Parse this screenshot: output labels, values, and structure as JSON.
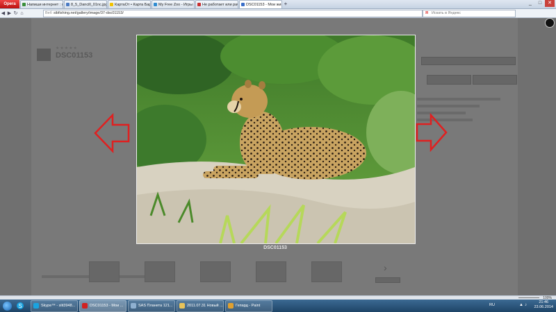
{
  "browser": {
    "menu_label": "Opera",
    "tabs": [
      {
        "label": "Напиши интернет : соо...",
        "color": "#3a8f3a"
      },
      {
        "label": "8_5_Dancill_01nc.jpg (800...",
        "color": "#4b7bc4"
      },
      {
        "label": "КартаОт • Карта Барн...",
        "color": "#f2c200"
      },
      {
        "label": "My Free Zoo - Игры в ...",
        "color": "#2f8bd0"
      },
      {
        "label": "Не работает или рабо...",
        "color": "#c83030"
      },
      {
        "label": "DSC01153 - Мои живо...",
        "color": "#3a6ec8",
        "active": true
      }
    ],
    "new_tab_label": "+",
    "window_controls": [
      "_",
      "□",
      "✕"
    ],
    "address_prefix": "Веб",
    "address": "sibfishing.net/gallery/image/37-dsc01153/",
    "search_placeholder": "Искать в Яндекс",
    "search_brand": "Я"
  },
  "page": {
    "ghost_title": "DSC01153",
    "ghost_stars": "★★★★★"
  },
  "lightbox": {
    "caption": "DSC01153",
    "prev_label": "Previous image",
    "next_label": "Next image",
    "arrow_color": "#e02020"
  },
  "statusbar": {
    "zoom": "100%"
  },
  "taskbar": {
    "items": [
      {
        "label": "Skype™ - slit3948...",
        "icon": "skype-icon",
        "color": "#1aa3e0"
      },
      {
        "label": "DSC01153 - Мои ...",
        "icon": "opera-icon",
        "color": "#d12222",
        "active": true
      },
      {
        "label": "SAS Планета 121...",
        "icon": "sas-planet-icon",
        "color": "#8fb0d0"
      },
      {
        "label": "2011.07.31 Новый ...",
        "icon": "folder-icon",
        "color": "#e8c35a"
      },
      {
        "label": "Гепард - Paint",
        "icon": "paint-icon",
        "color": "#e0a030"
      }
    ],
    "lang": "RU",
    "time": "21:46",
    "date": "23.06.2014"
  }
}
